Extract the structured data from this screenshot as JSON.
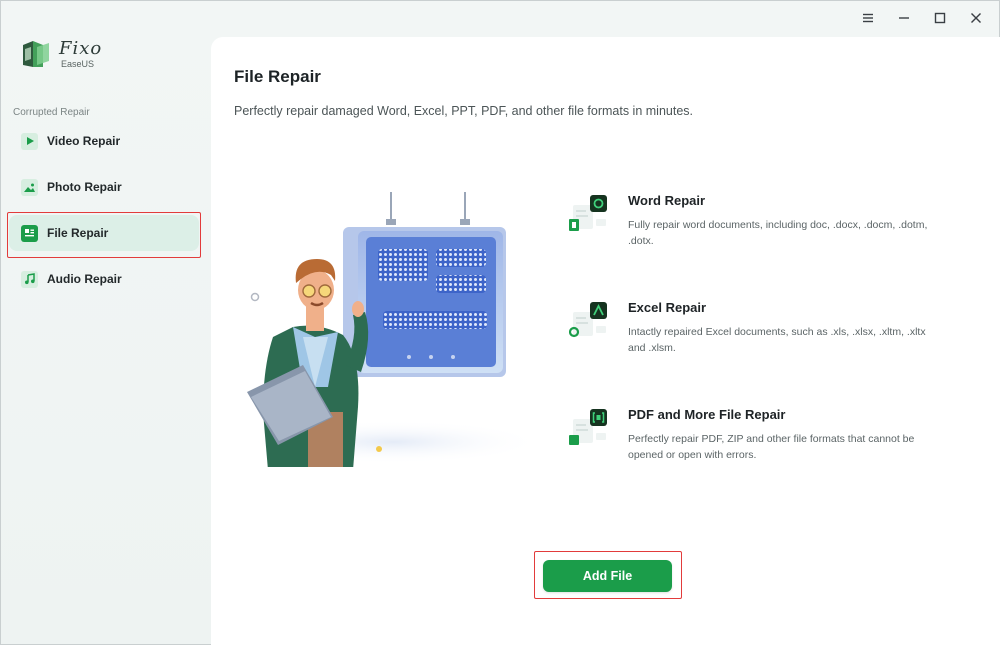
{
  "app": {
    "name": "Fixo",
    "vendor": "EaseUS"
  },
  "window_controls": [
    "menu-icon",
    "minimize-icon",
    "maximize-icon",
    "close-icon"
  ],
  "sidebar": {
    "section_label": "Corrupted Repair",
    "items": [
      {
        "label": "Video Repair",
        "icon": "video-icon",
        "active": false
      },
      {
        "label": "Photo Repair",
        "icon": "photo-icon",
        "active": false
      },
      {
        "label": "File Repair",
        "icon": "file-icon",
        "active": true
      },
      {
        "label": "Audio Repair",
        "icon": "audio-icon",
        "active": false
      }
    ]
  },
  "main": {
    "title": "File Repair",
    "subtitle": "Perfectly repair damaged Word, Excel, PPT, PDF, and other file formats in minutes.",
    "features": [
      {
        "title": "Word Repair",
        "desc": "Fully repair word documents, including doc, .docx, .docm, .dotm, .dotx.",
        "icon": "word-repair-icon"
      },
      {
        "title": "Excel Repair",
        "desc": "Intactly repaired Excel documents, such as .xls, .xlsx, .xltm, .xltx and .xlsm.",
        "icon": "excel-repair-icon"
      },
      {
        "title": "PDF and More File Repair",
        "desc": "Perfectly repair PDF, ZIP and other file formats that cannot be opened or open with errors.",
        "icon": "pdf-repair-icon"
      }
    ],
    "add_button_label": "Add File"
  },
  "colors": {
    "accent": "#1b9d4a",
    "active_bg": "#dcefe7",
    "highlight_border": "#e23b3b"
  }
}
